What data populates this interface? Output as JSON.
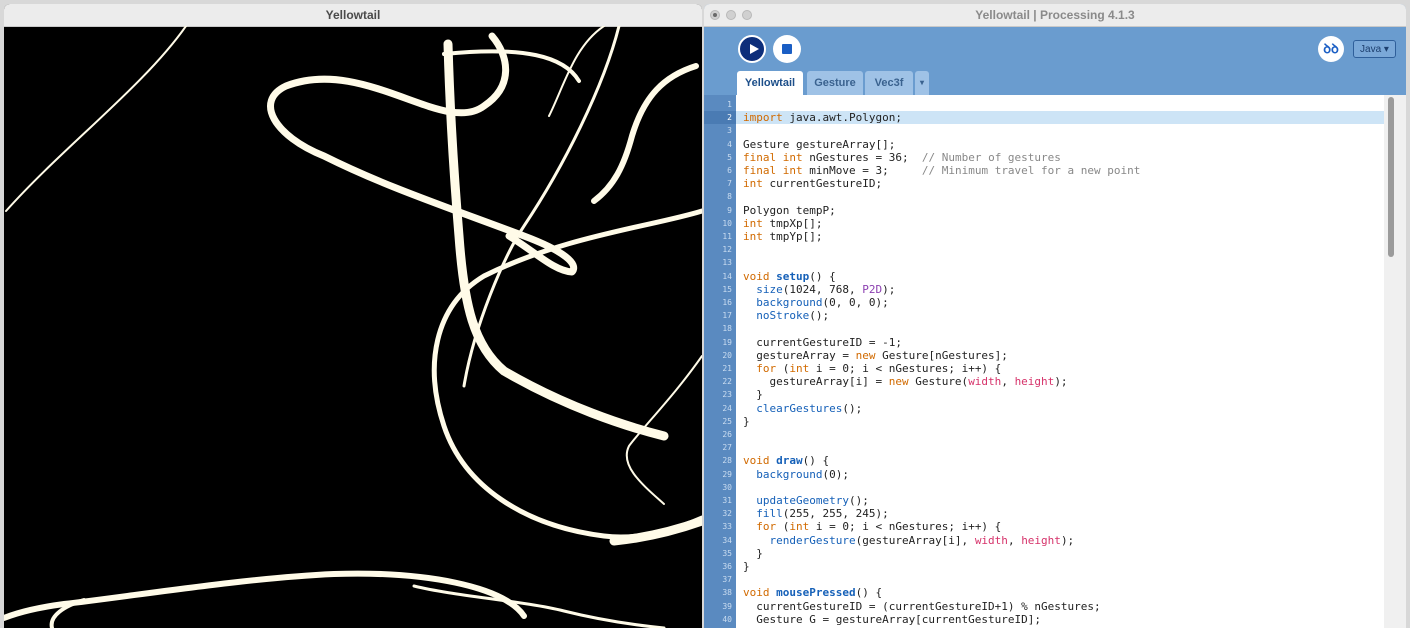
{
  "sketch_window": {
    "title": "Yellowtail"
  },
  "ide_window": {
    "title": "Yellowtail | Processing 4.1.3",
    "toolbar": {
      "debug_icon": "debug-butterfly-icon",
      "debug_glyph": "ꝺꝺ",
      "mode_label": "Java ▾"
    },
    "tabs": [
      {
        "label": "Yellowtail",
        "active": true
      },
      {
        "label": "Gesture",
        "active": false
      },
      {
        "label": "Vec3f",
        "active": false
      },
      {
        "label": "▾",
        "active": false
      }
    ],
    "current_line": 2,
    "colors": {
      "keyword": "#d16a00",
      "function": "#1560b8",
      "constant": "#d6326a",
      "comment": "#888888",
      "type": "#d16a00",
      "purple": "#8b3fb0"
    },
    "code_lines": [
      "",
      "import java.awt.Polygon;",
      "",
      "Gesture gestureArray[];",
      "final int nGestures = 36;  // Number of gestures",
      "final int minMove = 3;     // Minimum travel for a new point",
      "int currentGestureID;",
      "",
      "Polygon tempP;",
      "int tmpXp[];",
      "int tmpYp[];",
      "",
      "",
      "void setup() {",
      "  size(1024, 768, P2D);",
      "  background(0, 0, 0);",
      "  noStroke();",
      "",
      "  currentGestureID = -1;",
      "  gestureArray = new Gesture[nGestures];",
      "  for (int i = 0; i < nGestures; i++) {",
      "    gestureArray[i] = new Gesture(width, height);",
      "  }",
      "  clearGestures();",
      "}",
      "",
      "",
      "void draw() {",
      "  background(0);",
      "",
      "  updateGeometry();",
      "  fill(255, 255, 245);",
      "  for (int i = 0; i < nGestures; i++) {",
      "    renderGesture(gestureArray[i], width, height);",
      "  }",
      "}",
      "",
      "void mousePressed() {",
      "  currentGestureID = (currentGestureID+1) % nGestures;",
      "  Gesture G = gestureArray[currentGestureID];"
    ]
  }
}
